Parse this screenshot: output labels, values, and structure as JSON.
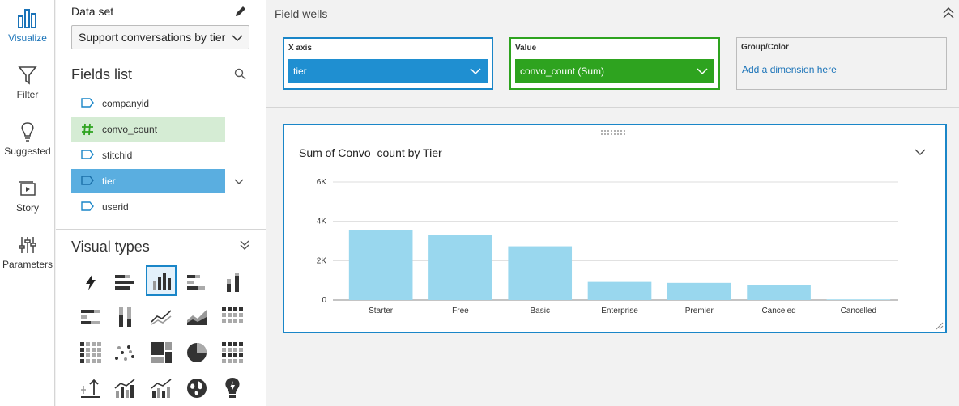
{
  "nav": {
    "items": [
      {
        "label": "Visualize",
        "icon": "visualize-icon"
      },
      {
        "label": "Filter",
        "icon": "filter-icon"
      },
      {
        "label": "Suggested",
        "icon": "lightbulb-icon"
      },
      {
        "label": "Story",
        "icon": "story-icon"
      },
      {
        "label": "Parameters",
        "icon": "parameters-icon"
      }
    ]
  },
  "dataset": {
    "label": "Data set",
    "selected": "Support conversations by tier"
  },
  "fields": {
    "title": "Fields list",
    "items": [
      {
        "name": "companyid",
        "kind": "dimension"
      },
      {
        "name": "convo_count",
        "kind": "measure"
      },
      {
        "name": "stitchid",
        "kind": "dimension"
      },
      {
        "name": "tier",
        "kind": "dimension"
      },
      {
        "name": "userid",
        "kind": "dimension"
      }
    ]
  },
  "visual_types": {
    "title": "Visual types"
  },
  "field_wells": {
    "title": "Field wells",
    "x_axis": {
      "label": "X axis",
      "value": "tier"
    },
    "value": {
      "label": "Value",
      "value": "convo_count (Sum)"
    },
    "group": {
      "label": "Group/Color",
      "placeholder": "Add a dimension here"
    }
  },
  "visual": {
    "title": "Sum of Convo_count by Tier"
  },
  "colors": {
    "accent": "#1a86c8",
    "bar": "#99d7ee",
    "measure": "#2ea31f"
  },
  "chart_data": {
    "type": "bar",
    "title": "Sum of Convo_count by Tier",
    "categories": [
      "Starter",
      "Free",
      "Basic",
      "Enterprise",
      "Premier",
      "Canceled",
      "Cancelled"
    ],
    "values": [
      3550,
      3300,
      2730,
      920,
      870,
      780,
      30
    ],
    "ylim": [
      0,
      6000
    ],
    "yticks": [
      0,
      2000,
      4000,
      6000
    ],
    "ytick_labels": [
      "0",
      "2K",
      "4K",
      "6K"
    ],
    "grid": true
  }
}
